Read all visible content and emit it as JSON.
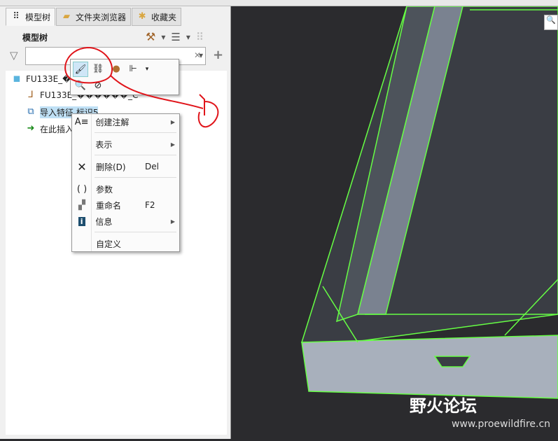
{
  "tabs": [
    {
      "label": "模型树"
    },
    {
      "label": "文件夹浏览器"
    },
    {
      "label": "收藏夹"
    }
  ],
  "panel_title": "模型树",
  "tree": [
    {
      "label": "FU133E_��"
    },
    {
      "label": "FU133E_������_C"
    },
    {
      "label": "导入特征 标识5"
    },
    {
      "label": "在此插入"
    }
  ],
  "context_menu": [
    {
      "label": "创建注解",
      "icon": "annotation-icon",
      "shortcut": "",
      "submenu": true
    },
    {
      "label": "表示",
      "icon": "",
      "shortcut": "",
      "submenu": true
    },
    {
      "label": "删除(D)",
      "icon": "delete-icon",
      "shortcut": "Del",
      "submenu": false
    },
    {
      "label": "参数",
      "icon": "parameters-icon",
      "shortcut": "",
      "submenu": false
    },
    {
      "label": "重命名",
      "icon": "rename-icon",
      "shortcut": "F2",
      "submenu": false
    },
    {
      "label": "信息",
      "icon": "info-icon",
      "shortcut": "",
      "submenu": true
    },
    {
      "label": "自定义",
      "icon": "",
      "shortcut": "",
      "submenu": false
    }
  ],
  "annotation_mark": "1",
  "watermark": {
    "title": "野火论坛",
    "url": "www.proewildfire.cn"
  },
  "colors": {
    "wire": "#66ff44",
    "selection": "#bfe0f5",
    "annotation": "#e0141a"
  }
}
